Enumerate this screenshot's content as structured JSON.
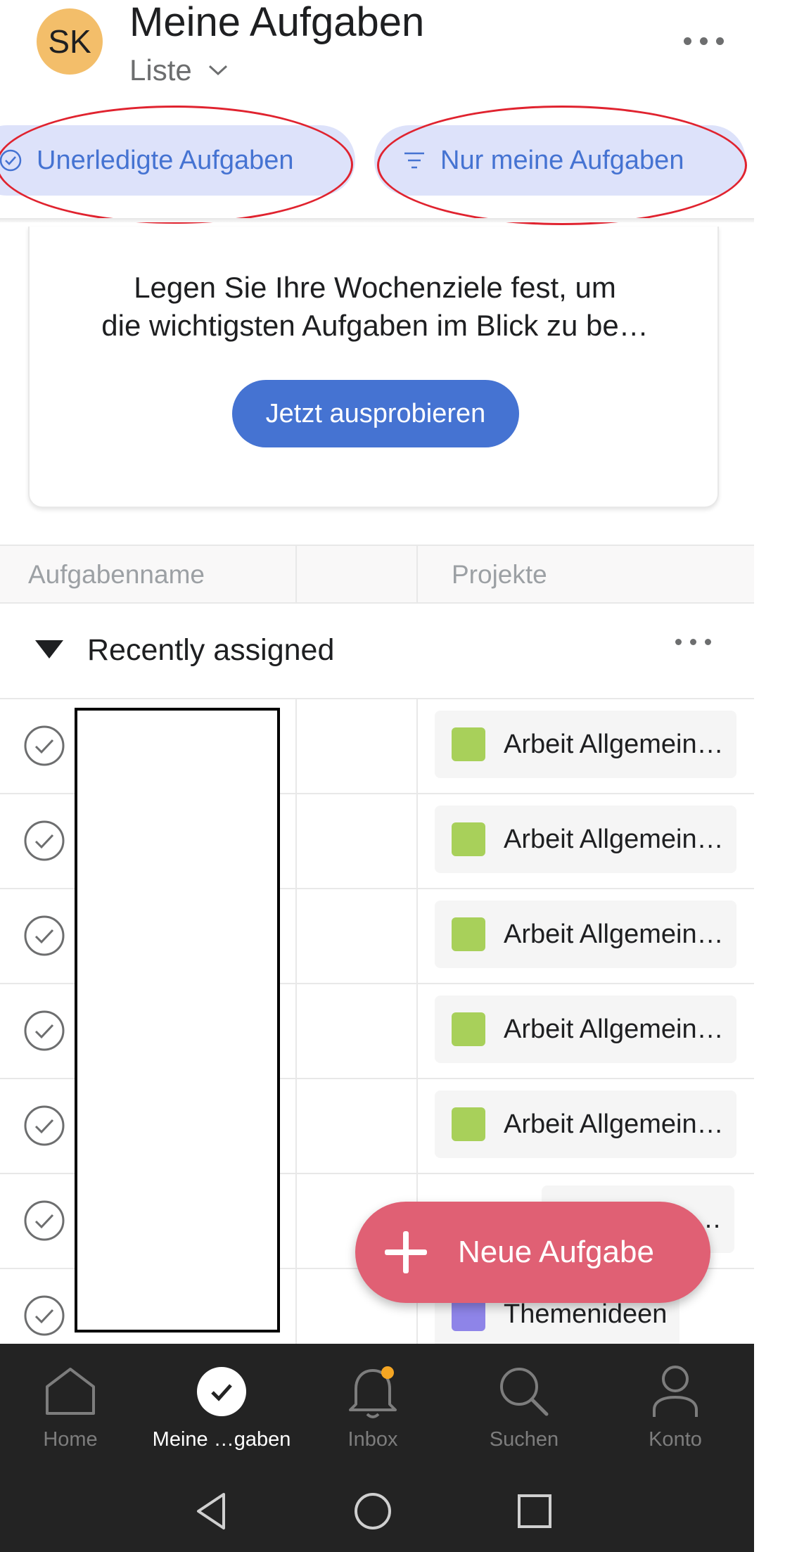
{
  "header": {
    "avatar_initials": "SK",
    "title": "Meine Aufgaben",
    "view": "Liste",
    "more_icon": "more-horizontal-icon"
  },
  "filters": [
    {
      "label": "Unerledigte Aufgaben",
      "icon": "check-circle-icon"
    },
    {
      "label": "Nur meine Aufgaben",
      "icon": "filter-icon"
    }
  ],
  "goals_card": {
    "line1": "Legen Sie Ihre Wochenziele fest, um",
    "line2": "die wichtigsten Aufgaben im Blick zu be…",
    "button": "Jetzt ausprobieren"
  },
  "table": {
    "columns": [
      "Aufgabenname",
      "Projekte"
    ]
  },
  "section": {
    "title": "Recently assigned"
  },
  "rows": [
    {
      "project": "Arbeit Allgemein…",
      "color": "#a8d05a"
    },
    {
      "project": "Arbeit Allgemein…",
      "color": "#a8d05a"
    },
    {
      "project": "Arbeit Allgemein…",
      "color": "#a8d05a"
    },
    {
      "project": "Arbeit Allgemein…",
      "color": "#a8d05a"
    },
    {
      "project": "Arbeit Allgemein…",
      "color": "#a8d05a"
    },
    {
      "project": "…",
      "color": "#a8d05a"
    },
    {
      "project": "Themenideen",
      "color": "#8e84e8"
    }
  ],
  "fab": {
    "label": "Neue Aufgabe"
  },
  "bottom_nav": [
    {
      "label": "Home",
      "icon": "home-icon",
      "active": false
    },
    {
      "label": "Meine …gaben",
      "icon": "check-icon",
      "active": true
    },
    {
      "label": "Inbox",
      "icon": "bell-icon",
      "active": false
    },
    {
      "label": "Suchen",
      "icon": "search-icon",
      "active": false
    },
    {
      "label": "Konto",
      "icon": "person-icon",
      "active": false
    }
  ],
  "colors": {
    "accent": "#4573d2",
    "chip_bg": "#dde2fa",
    "fab": "#e06074",
    "annotation": "#e0232f",
    "nav_bg": "#232323"
  }
}
